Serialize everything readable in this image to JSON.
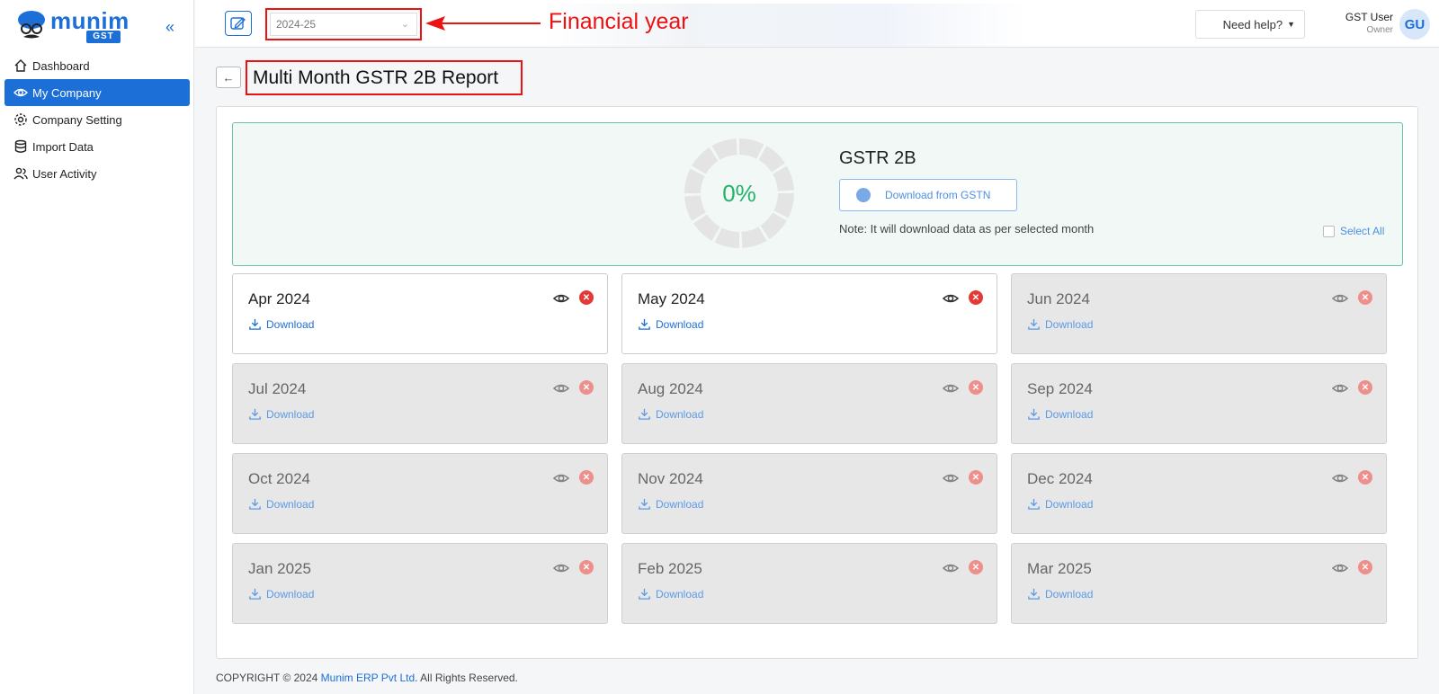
{
  "brand": {
    "name": "munim",
    "badge": "GST"
  },
  "sidebar": {
    "collapse_icon": "«",
    "items": [
      {
        "label": "Dashboard",
        "icon": "home-icon",
        "active": false
      },
      {
        "label": "My Company",
        "icon": "eye-icon",
        "active": true
      },
      {
        "label": "Company Setting",
        "icon": "gear-icon",
        "active": false
      },
      {
        "label": "Import Data",
        "icon": "database-icon",
        "active": false
      },
      {
        "label": "User Activity",
        "icon": "users-icon",
        "active": false
      }
    ]
  },
  "topbar": {
    "financial_year": "2024-25",
    "annotation": "Financial year",
    "help_label": "Need help?",
    "user_name": "GST User",
    "user_role": "Owner",
    "avatar_initials": "GU"
  },
  "page": {
    "back_label": "←",
    "title": "Multi Month GSTR 2B Report"
  },
  "summary": {
    "progress_label": "0%",
    "progress_value": 0,
    "title": "GSTR 2B",
    "download_button": "Download from GSTN",
    "note": "Note: It will download data as per selected month",
    "select_all": "Select All"
  },
  "months": [
    {
      "name": "Apr 2024",
      "download": "Download",
      "enabled": true
    },
    {
      "name": "May 2024",
      "download": "Download",
      "enabled": true
    },
    {
      "name": "Jun 2024",
      "download": "Download",
      "enabled": false
    },
    {
      "name": "Jul 2024",
      "download": "Download",
      "enabled": false
    },
    {
      "name": "Aug 2024",
      "download": "Download",
      "enabled": false
    },
    {
      "name": "Sep 2024",
      "download": "Download",
      "enabled": false
    },
    {
      "name": "Oct 2024",
      "download": "Download",
      "enabled": false
    },
    {
      "name": "Nov 2024",
      "download": "Download",
      "enabled": false
    },
    {
      "name": "Dec 2024",
      "download": "Download",
      "enabled": false
    },
    {
      "name": "Jan 2025",
      "download": "Download",
      "enabled": false
    },
    {
      "name": "Feb 2025",
      "download": "Download",
      "enabled": false
    },
    {
      "name": "Mar 2025",
      "download": "Download",
      "enabled": false
    }
  ],
  "footer": {
    "prefix": "COPYRIGHT © 2024",
    "company": "Munim ERP Pvt Ltd",
    "suffix": ". All Rights Reserved."
  },
  "colors": {
    "accent": "#1d6fd8",
    "annotation": "#ee1111",
    "success": "#25b26a",
    "danger": "#e53935"
  }
}
